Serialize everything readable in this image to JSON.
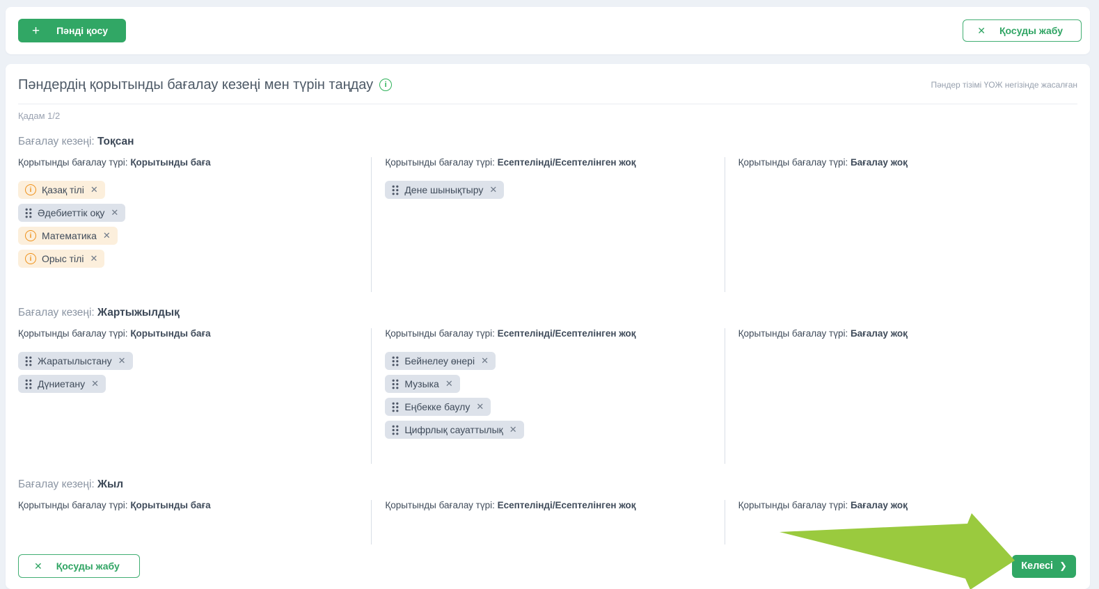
{
  "topbar": {
    "add_button": {
      "label": "Пәнді қосу",
      "icon": "plus-icon",
      "icon_glyph": "+"
    },
    "close_button": {
      "label": "Қосуды жабу",
      "icon": "x-icon",
      "icon_glyph": "✕"
    }
  },
  "panel": {
    "title": "Пәндердің қорытынды бағалау кезеңі мен түрін таңдау",
    "title_info_glyph": "i",
    "note": "Пәндер тізімі ҮОЖ негізінде жасалған",
    "step": "Қадам 1/2",
    "period_label": "Бағалау кезеңі:",
    "type_label": "Қорытынды бағалау түрі:",
    "sections": [
      {
        "period": "Тоқсан",
        "columns": [
          {
            "type": "Қорытынды баға",
            "tags": [
              {
                "label": "Қазақ тілі",
                "variant": "warning"
              },
              {
                "label": "Әдебиеттік оқу",
                "variant": "default"
              },
              {
                "label": "Математика",
                "variant": "warning"
              },
              {
                "label": "Орыс тілі",
                "variant": "warning"
              }
            ]
          },
          {
            "type": "Есептелінді/Есептелінген жоқ",
            "tags": [
              {
                "label": "Дене шынықтыру",
                "variant": "default"
              }
            ]
          },
          {
            "type": "Бағалау жоқ",
            "tags": []
          }
        ]
      },
      {
        "period": "Жартыжылдық",
        "columns": [
          {
            "type": "Қорытынды баға",
            "tags": [
              {
                "label": "Жаратылыстану",
                "variant": "default"
              },
              {
                "label": "Дүниетану",
                "variant": "default"
              }
            ]
          },
          {
            "type": "Есептелінді/Есептелінген жоқ",
            "tags": [
              {
                "label": "Бейнелеу өнері",
                "variant": "default"
              },
              {
                "label": "Музыка",
                "variant": "default"
              },
              {
                "label": "Еңбекке баулу",
                "variant": "default"
              },
              {
                "label": "Цифрлық сауаттылық",
                "variant": "default"
              }
            ]
          },
          {
            "type": "Бағалау жоқ",
            "tags": []
          }
        ]
      },
      {
        "period": "Жыл",
        "columns": [
          {
            "type": "Қорытынды баға",
            "tags": []
          },
          {
            "type": "Есептелінді/Есептелінген жоқ",
            "tags": []
          },
          {
            "type": "Бағалау жоқ",
            "tags": []
          }
        ]
      }
    ],
    "footer": {
      "close_button": {
        "label": "Қосуды жабу",
        "icon": "x-icon",
        "icon_glyph": "✕"
      },
      "next_button": {
        "label": "Келесі",
        "icon": "chevron-right-icon",
        "icon_glyph": "❯"
      }
    }
  },
  "tag_close_glyph": "✕",
  "annotation": {
    "type": "arrow",
    "color": "#9aca3e",
    "points_to": "next-button"
  },
  "colors": {
    "page_bg": "#edf1f6",
    "accent_green": "#31a765",
    "outline_green": "#41ae72",
    "info_green": "#2db159",
    "warning_orange": "#ee9019",
    "tag_warning_bg": "#fcefdc",
    "tag_default_bg": "#dde2ea",
    "arrow_green": "#9aca3e"
  }
}
